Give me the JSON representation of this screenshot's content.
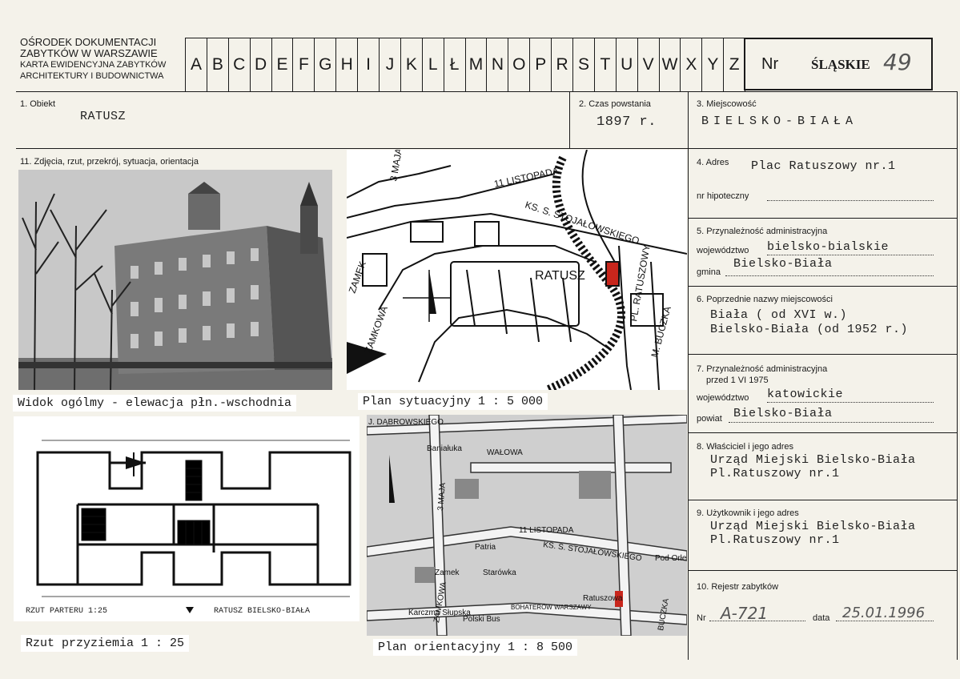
{
  "header": {
    "inst1": "OŚRODEK DOKUMENTACJI",
    "inst2": "ZABYTKÓW W WARSZAWIE",
    "inst3": "KARTA EWIDENCYJNA ZABYTKÓW",
    "inst4": "ARCHITEKTURY I BUDOWNICTWA",
    "letters": [
      "A",
      "B",
      "C",
      "D",
      "E",
      "F",
      "G",
      "H",
      "I",
      "J",
      "K",
      "L",
      "Ł",
      "M",
      "N",
      "O",
      "P",
      "R",
      "S",
      "T",
      "U",
      "V",
      "W",
      "X",
      "Y",
      "Z"
    ],
    "nr_label": "Nr",
    "nr_region": "ŚLĄSKIE",
    "nr_number": "49"
  },
  "fields": {
    "f1_label": "1. Obiekt",
    "f1_value": "RATUSZ",
    "f2_label": "2. Czas powstania",
    "f2_value": "1897 r.",
    "f3_label": "3. Miejscowość",
    "f3_value": "BIELSKO-BIAŁA",
    "f4_label": "4. Adres",
    "f4_value": "Plac Ratuszowy nr.1",
    "f4_hip_label": "nr hipoteczny",
    "f5_label": "5. Przynależność administracyjna",
    "f5_woj_label": "województwo",
    "f5_woj_value": "bielsko-bialskie",
    "f5_gmina_label": "gmina",
    "f5_gmina_value": "Bielsko-Biała",
    "f6_label": "6. Poprzednie nazwy miejscowości",
    "f6_line1": "Biała ( od XVI  w.)",
    "f6_line2": "Bielsko-Biała (od  1952 r.)",
    "f7_label": "7. Przynależność administracyjna",
    "f7_sub": "przed 1 VI 1975",
    "f7_woj_label": "województwo",
    "f7_woj_value": "katowickie",
    "f7_powiat_label": "powiat",
    "f7_powiat_value": "Bielsko-Biała",
    "f8_label": "8. Właściciel i jego adres",
    "f8_line1": "Urząd Miejski Bielsko-Biała",
    "f8_line2": "Pl.Ratuszowy nr.1",
    "f9_label": "9. Użytkownik i jego adres",
    "f9_line1": "Urząd Miejski Bielsko-Biała",
    "f9_line2": "Pl.Ratuszowy nr.1",
    "f10_label": "10. Rejestr zabytków",
    "f10_nr_label": "Nr",
    "f10_nr_value": "A-721",
    "f10_date_label": "data",
    "f10_date_value": "25.01.1996",
    "f11_label": "11. Zdjęcia, rzut, przekrój, sytuacja, orientacja"
  },
  "captions": {
    "photo": "Widok ogólmy - elewacja płn.-wschodnia",
    "plan_sit": "Plan sytuacyjny 1 : 5 000",
    "plan_floor": "Rzut przyziemia 1 : 25",
    "plan_orient": "Plan orientacyjny 1 : 8 500"
  },
  "map1": {
    "streets": [
      "3 MAJA",
      "11 LISTOPADA",
      "KS. S. STOJAŁOWSKIEGO",
      "ZAMEK",
      "ZAMKOWA",
      "RATUSZ",
      "PL. RATUSZOWY",
      "M. BUCZKA"
    ]
  },
  "map2": {
    "streets": [
      "J. DĄBROWSKIEGO",
      "WAŁOWA",
      "11 LISTOPADA",
      "KS. S. STOJAŁOWSKIEGO",
      "3 MAJA",
      "ZAMKOWA",
      "BOHATERÓW WARSZAWY",
      "BUCZKA"
    ],
    "places": [
      "Baniałuka",
      "Zamek",
      "Starówka",
      "Patria",
      "Ratuszowa",
      "Pod Orłem",
      "Karczma Słupska",
      "Polski Bus"
    ]
  },
  "floorplan": {
    "label_left": "RZUT PARTERU 1:25",
    "label_right": "RATUSZ BIELSKO-BIAŁA"
  }
}
